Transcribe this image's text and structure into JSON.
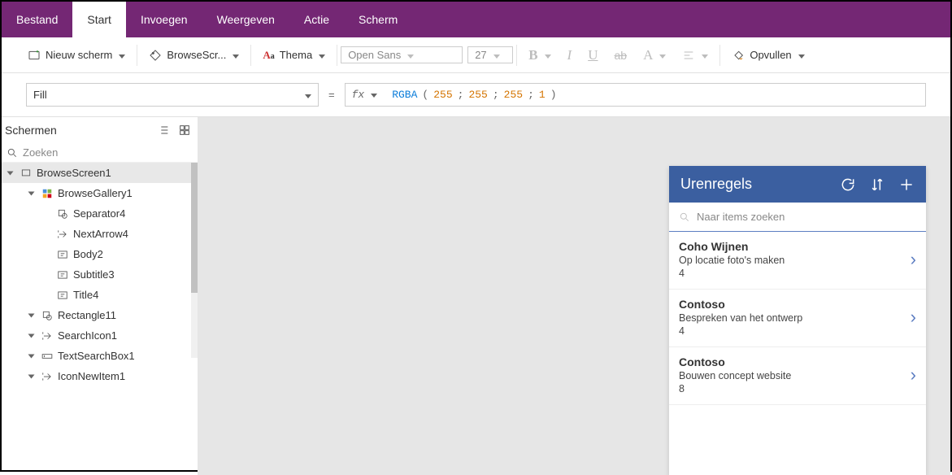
{
  "appbar": {
    "tabs": [
      "Bestand",
      "Start",
      "Invoegen",
      "Weergeven",
      "Actie",
      "Scherm"
    ],
    "activeIndex": 1
  },
  "ribbon": {
    "newScreen": "Nieuw scherm",
    "browseScr": "BrowseScr...",
    "thema": "Thema",
    "font": "Open Sans",
    "fontSize": "27",
    "opvullen": "Opvullen"
  },
  "formula": {
    "property": "Fill",
    "fn": "RGBA",
    "args": [
      "255",
      "255",
      "255",
      "1"
    ]
  },
  "sidebar": {
    "title": "Schermen",
    "searchPlaceholder": "Zoeken",
    "tree": [
      {
        "label": "BrowseScreen1",
        "type": "screen",
        "indent": 1,
        "selected": true
      },
      {
        "label": "BrowseGallery1",
        "type": "gallery",
        "indent": 2
      },
      {
        "label": "Separator4",
        "type": "shape",
        "indent": 3
      },
      {
        "label": "NextArrow4",
        "type": "icon",
        "indent": 3
      },
      {
        "label": "Body2",
        "type": "text",
        "indent": 3
      },
      {
        "label": "Subtitle3",
        "type": "text",
        "indent": 3
      },
      {
        "label": "Title4",
        "type": "text",
        "indent": 3
      },
      {
        "label": "Rectangle11",
        "type": "shape",
        "indent": 2
      },
      {
        "label": "SearchIcon1",
        "type": "icon",
        "indent": 2
      },
      {
        "label": "TextSearchBox1",
        "type": "textbox",
        "indent": 2
      },
      {
        "label": "IconNewItem1",
        "type": "icon",
        "indent": 2
      }
    ]
  },
  "preview": {
    "title": "Urenregels",
    "searchPlaceholder": "Naar items zoeken",
    "items": [
      {
        "title": "Coho Wijnen",
        "subtitle": "Op locatie foto's maken",
        "body": "4"
      },
      {
        "title": "Contoso",
        "subtitle": "Bespreken van het ontwerp",
        "body": "4"
      },
      {
        "title": "Contoso",
        "subtitle": "Bouwen concept website",
        "body": "8"
      }
    ]
  }
}
